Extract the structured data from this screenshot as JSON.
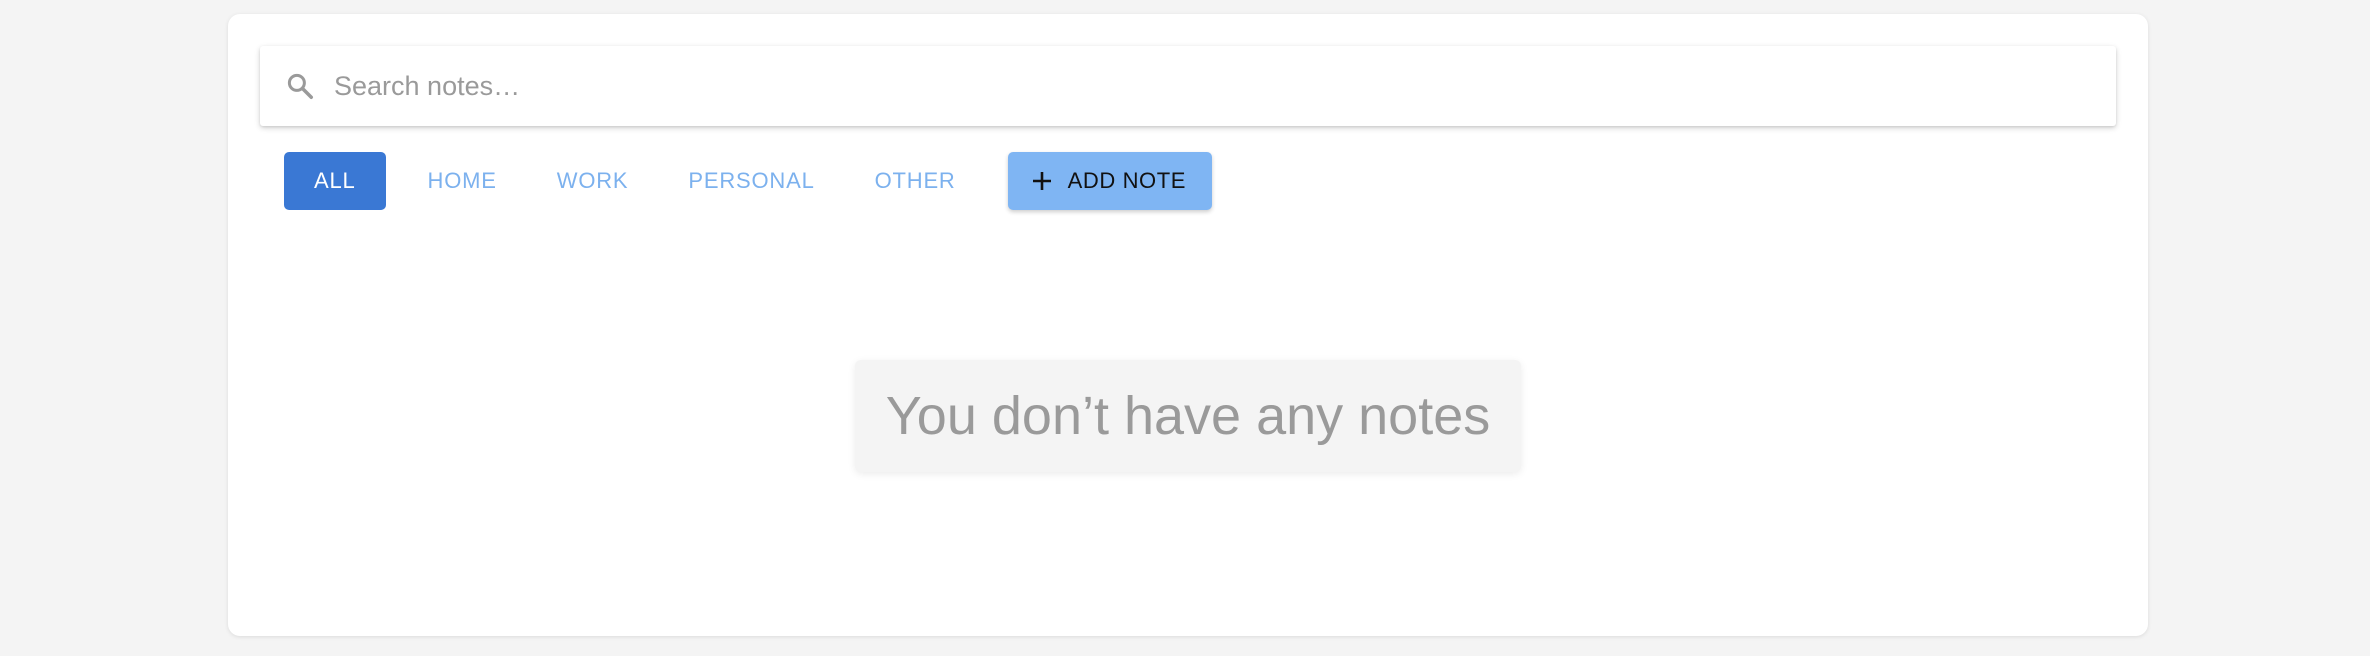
{
  "search": {
    "placeholder": "Search notes…",
    "icon": "search-icon"
  },
  "filters": [
    {
      "label": "ALL",
      "active": true
    },
    {
      "label": "HOME",
      "active": false
    },
    {
      "label": "WORK",
      "active": false
    },
    {
      "label": "PERSONAL",
      "active": false
    },
    {
      "label": "OTHER",
      "active": false
    }
  ],
  "add_note": {
    "label": "ADD NOTE",
    "icon": "plus-icon"
  },
  "empty_state": {
    "message": "You don’t have any notes"
  },
  "colors": {
    "accent": "#3a78d4",
    "accent_light": "#7fb5f3",
    "filter_text": "#7cb1ee",
    "muted_text": "#9a9a9a",
    "page_bg": "#f4f4f4"
  }
}
